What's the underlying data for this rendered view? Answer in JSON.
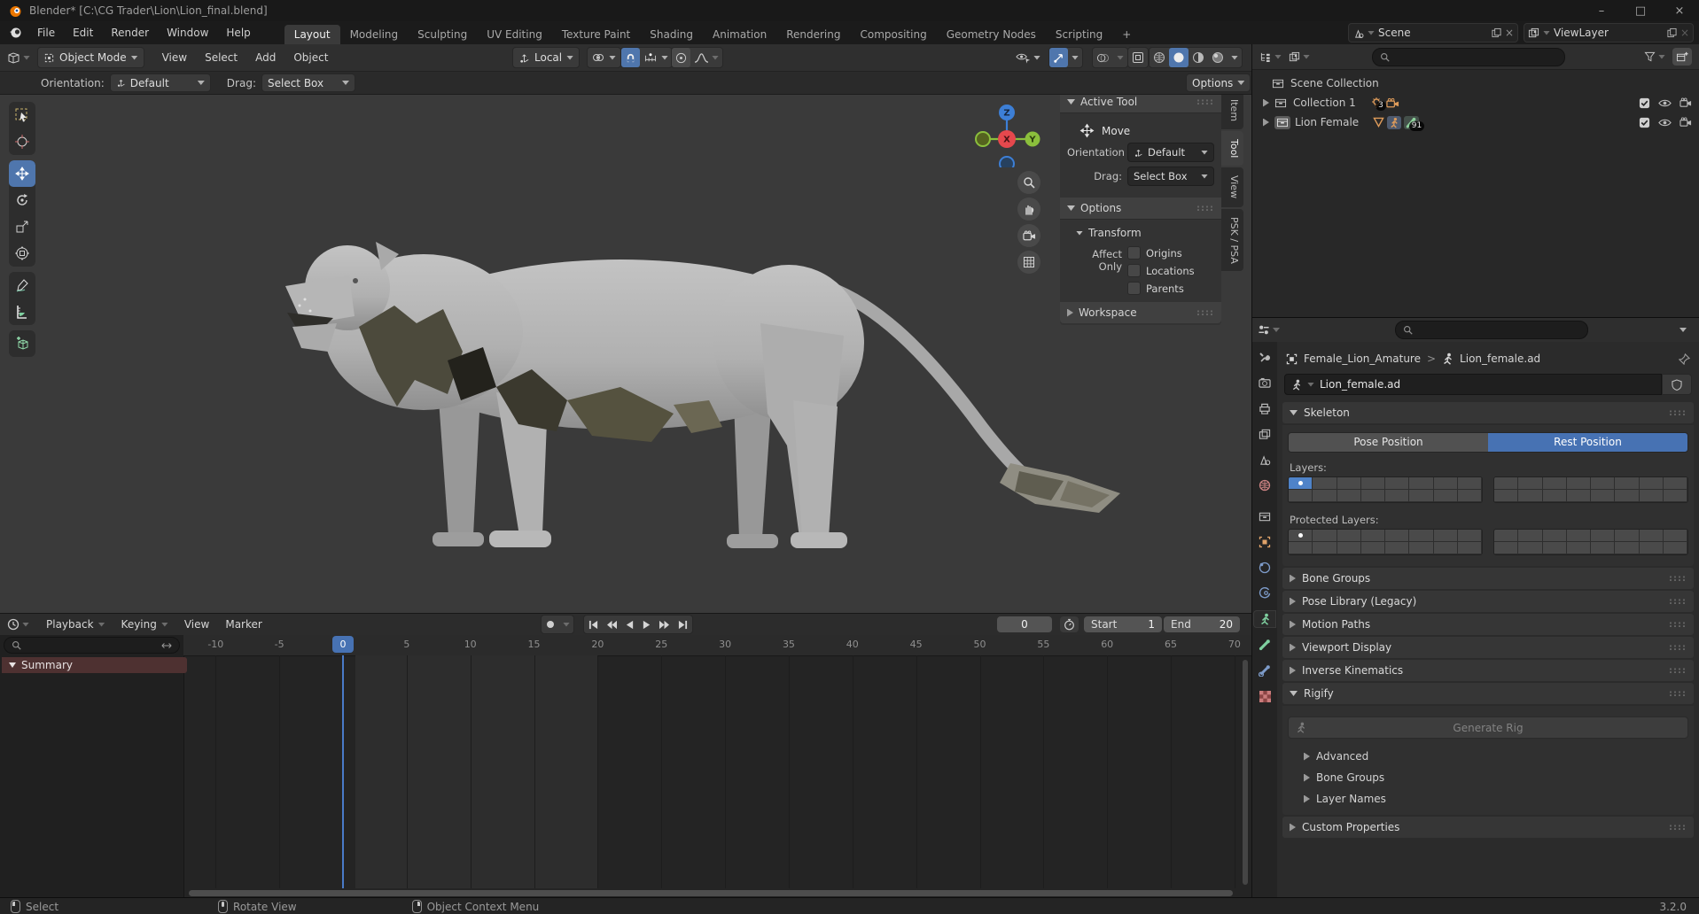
{
  "window": {
    "title": "Blender* [C:\\CG Trader\\Lion\\Lion_final.blend]",
    "controls": {
      "minimize": "–",
      "maximize": "□",
      "close": "×"
    }
  },
  "topbar": {
    "menus": [
      {
        "label": "File"
      },
      {
        "label": "Edit"
      },
      {
        "label": "Render"
      },
      {
        "label": "Window"
      },
      {
        "label": "Help"
      }
    ],
    "tabs": [
      {
        "label": "Layout",
        "active": true
      },
      {
        "label": "Modeling"
      },
      {
        "label": "Sculpting"
      },
      {
        "label": "UV Editing"
      },
      {
        "label": "Texture Paint"
      },
      {
        "label": "Shading"
      },
      {
        "label": "Animation"
      },
      {
        "label": "Rendering"
      },
      {
        "label": "Compositing"
      },
      {
        "label": "Geometry Nodes"
      },
      {
        "label": "Scripting"
      }
    ],
    "add_tab_label": "+",
    "scene_selector": {
      "value": "Scene",
      "clear": "×"
    },
    "view_layer_selector": {
      "value": "ViewLayer",
      "clear": "×"
    }
  },
  "viewport": {
    "header": {
      "mode": "Object Mode",
      "menus": [
        {
          "label": "View"
        },
        {
          "label": "Select"
        },
        {
          "label": "Add"
        },
        {
          "label": "Object"
        }
      ],
      "transform_orientation": "Local"
    },
    "tool_settings": {
      "orientation_label": "Orientation:",
      "orientation_value": "Default",
      "drag_label": "Drag:",
      "drag_value": "Select Box",
      "options_label": "Options"
    },
    "toolbar_tools": [
      "select-box",
      "cursor",
      "move",
      "rotate",
      "scale",
      "transform",
      "annotate",
      "measure",
      "add-cube"
    ],
    "active_tool": "move",
    "gizmo_axes": {
      "x": "X",
      "y": "Y",
      "z": "Z"
    },
    "axis_colors": {
      "x": "#e5484d",
      "y": "#8bbf3c",
      "z": "#3d7fd6"
    }
  },
  "n_panel": {
    "tabs": [
      {
        "label": "Item"
      },
      {
        "label": "Tool",
        "active": true
      },
      {
        "label": "View"
      },
      {
        "label": "PSK / PSA"
      }
    ],
    "active_tool_panel": {
      "title": "Active Tool",
      "tool_name": "Move",
      "orientation_label": "Orientation",
      "orientation_value": "Default",
      "drag_label": "Drag:",
      "drag_value": "Select Box"
    },
    "options_panel": {
      "title": "Options",
      "transform_title": "Transform",
      "affect_only_label": "Affect Only",
      "checkboxes": [
        {
          "label": "Origins",
          "checked": false
        },
        {
          "label": "Locations",
          "checked": false
        },
        {
          "label": "Parents",
          "checked": false
        }
      ]
    },
    "workspace_title": "Workspace"
  },
  "outliner": {
    "rows": [
      {
        "label": "Scene Collection"
      },
      {
        "label": "Collection 1",
        "light_count": "3"
      },
      {
        "label": "Lion Female",
        "bone_count": "91",
        "selected": true
      }
    ]
  },
  "properties": {
    "tab_icons": [
      "tool-icon",
      "render-icon",
      "output-icon",
      "view-layer-icon",
      "scene-icon",
      "world-icon",
      "collection-icon",
      "object-icon",
      "physics-icon",
      "constraints-icon",
      "object-data-icon",
      "bone-icon",
      "bone-constraint-icon",
      "texture-icon"
    ],
    "active_tab": "object-data-icon",
    "breadcrumb": {
      "object": "Female_Lion_Amature",
      "separator": ">",
      "data": "Lion_female.ad"
    },
    "name_field": {
      "value": "Lion_female.ad"
    },
    "skeleton": {
      "title": "Skeleton",
      "pose_label": "Pose Position",
      "rest_label": "Rest Position",
      "active_mode": "Rest Position",
      "layers_label": "Layers:",
      "protected_label": "Protected Layers:",
      "layers_active_cell": 0,
      "protected_dot_cell": 0
    },
    "collapsed_panels": [
      {
        "label": "Bone Groups"
      },
      {
        "label": "Pose Library (Legacy)"
      },
      {
        "label": "Motion Paths"
      },
      {
        "label": "Viewport Display"
      },
      {
        "label": "Inverse Kinematics"
      }
    ],
    "rigify": {
      "title": "Rigify",
      "generate_label": "Generate Rig",
      "sub_panels": [
        {
          "label": "Advanced"
        },
        {
          "label": "Bone Groups"
        },
        {
          "label": "Layer Names"
        }
      ]
    },
    "custom_properties_label": "Custom Properties"
  },
  "timeline": {
    "menus": [
      {
        "label": "Playback",
        "dropdown": true
      },
      {
        "label": "Keying",
        "dropdown": true
      },
      {
        "label": "View"
      },
      {
        "label": "Marker"
      }
    ],
    "current_frame": "0",
    "start_label": "Start",
    "start_value": "1",
    "end_label": "End",
    "end_value": "20",
    "frame_range": {
      "start": 1,
      "end": 20
    },
    "ruler_frames": [
      -10,
      -5,
      0,
      5,
      10,
      15,
      20,
      25,
      30,
      35,
      40,
      45,
      50,
      55,
      60,
      65,
      70
    ],
    "summary_label": "Summary"
  },
  "status_bar": {
    "hints": [
      {
        "icon": "mouse-left-icon",
        "label": "Select"
      },
      {
        "icon": "mouse-middle-icon",
        "label": "Rotate View"
      },
      {
        "icon": "mouse-right-icon",
        "label": "Object Context Menu"
      }
    ],
    "version": "3.2.0"
  }
}
